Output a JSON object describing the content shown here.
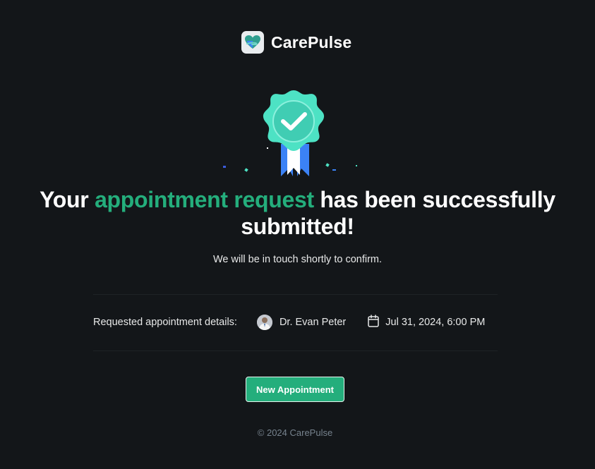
{
  "brand": {
    "name": "CarePulse",
    "icon": "heart-hands-logo-icon"
  },
  "success": {
    "icon": "award-badge-checkmark-icon",
    "headline_before": "Your ",
    "headline_accent": "appointment request",
    "headline_after": " has been successfully submitted!",
    "subtext": "We will be in touch shortly to confirm."
  },
  "details": {
    "label": "Requested appointment details:",
    "doctor_name": "Dr. Evan Peter",
    "doctor_avatar_icon": "doctor-avatar",
    "datetime": "Jul 31, 2024, 6:00 PM",
    "calendar_icon": "calendar-icon"
  },
  "actions": {
    "new_appointment_label": "New Appointment"
  },
  "footer": {
    "copyright": "© 2024 CarePulse"
  },
  "colors": {
    "background": "#131619",
    "accent": "#24ae7c",
    "badge": "#4de2c4",
    "ribbon": "#3b82f6",
    "muted": "#76828d"
  }
}
